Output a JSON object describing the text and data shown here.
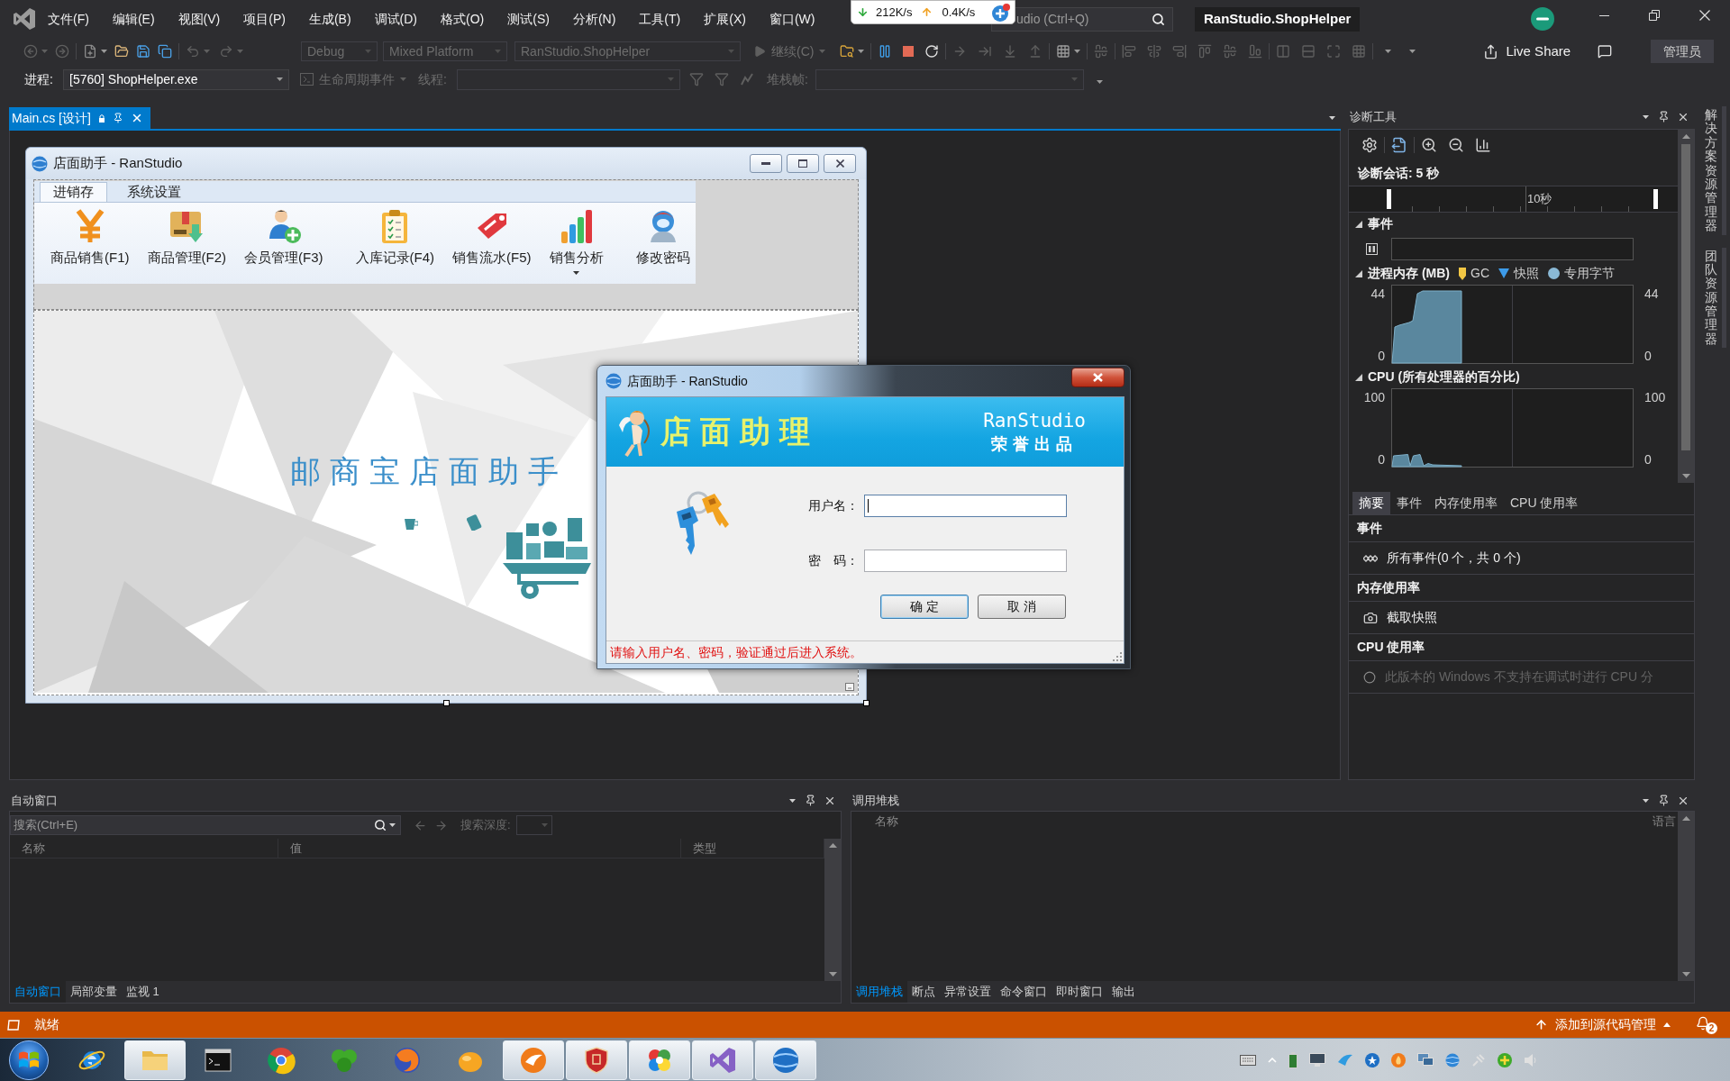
{
  "title_bar": {
    "menu": [
      "文件(F)",
      "编辑(E)",
      "视图(V)",
      "项目(P)",
      "生成(B)",
      "调试(D)",
      "格式(O)",
      "测试(S)",
      "分析(N)",
      "工具(T)",
      "扩展(X)",
      "窗口(W)"
    ],
    "quick_launch": {
      "placeholder": "udio (Ctrl+Q)"
    },
    "solution_name": "RanStudio.ShopHelper"
  },
  "net_speed_widget": {
    "download": "212K/s",
    "upload": "0.4K/s"
  },
  "toolbar": {
    "configuration": {
      "value": "Debug",
      "disabled": true
    },
    "platform": {
      "value": "Mixed Platform",
      "disabled": true
    },
    "startup_project": {
      "value": "RanStudio.ShopHelper",
      "disabled": true
    },
    "continue_button": {
      "label": "继续(C)",
      "disabled": true
    },
    "live_share": "Live Share",
    "admin_badge": "管理员"
  },
  "debug_location_bar": {
    "process_label": "进程:",
    "process": "[5760] ShopHelper.exe",
    "lifecycle_events": {
      "label": "生命周期事件",
      "disabled": true
    },
    "thread_label": {
      "label": "线程:",
      "disabled": true
    },
    "stack_frame_label": {
      "label": "堆栈帧:",
      "disabled": true
    }
  },
  "document_tabs": [
    {
      "label": "Main.cs [设计]",
      "selected": true
    }
  ],
  "designer_form": {
    "title": "店面助手 - RanStudio",
    "ribbon_tabs": [
      {
        "label": "进销存",
        "selected": true
      },
      {
        "label": "系统设置",
        "selected": false
      }
    ],
    "ribbon_groups": [
      {
        "buttons": [
          {
            "label": "商品销售(F1)",
            "dropdown": false
          },
          {
            "label": "商品管理(F2)",
            "dropdown": false
          },
          {
            "label": "会员管理(F3)",
            "dropdown": false
          }
        ]
      },
      {
        "buttons": [
          {
            "label": "入库记录(F4)",
            "dropdown": false
          },
          {
            "label": "销售流水(F5)",
            "dropdown": false
          },
          {
            "label": "销售分析",
            "dropdown": true
          }
        ]
      },
      {
        "buttons": [
          {
            "label": "修改密码",
            "dropdown": false
          }
        ]
      }
    ],
    "banner_text": "邮商宝店面助手"
  },
  "login_dialog": {
    "title": "店面助手 - RanStudio",
    "banner": {
      "title": "店面助理",
      "brand": "RanStudio",
      "tagline": "荣誉出品"
    },
    "fields": [
      {
        "label": "用户名：",
        "focused": true
      },
      {
        "label": "密　码：",
        "focused": false
      }
    ],
    "buttons": [
      {
        "label": "确 定",
        "default": true
      },
      {
        "label": "取 消",
        "default": false
      }
    ],
    "status": "请输入用户名、密码，验证通过后进入系统。"
  },
  "diagnostic_tools": {
    "title": "诊断工具",
    "session": "诊断会话: 5 秒",
    "timeline_label": "10秒",
    "sections": [
      {
        "kind": "events",
        "title": "事件",
        "expanded": true
      },
      {
        "kind": "memory",
        "title": "进程内存 (MB)",
        "expanded": true,
        "legend": [
          {
            "kind": "gc",
            "label": "GC"
          },
          {
            "kind": "snapshot",
            "label": "快照"
          },
          {
            "kind": "private_bytes",
            "label": "专用字节"
          }
        ],
        "axis": {
          "left_max": "44",
          "left_min": "0",
          "right_max": "44",
          "right_min": "0"
        }
      },
      {
        "kind": "cpu",
        "title": "CPU (所有处理器的百分比)",
        "expanded": true,
        "axis": {
          "left_max": "100",
          "left_min": "0",
          "right_max": "100",
          "right_min": "0"
        }
      }
    ],
    "tabs": [
      {
        "label": "摘要",
        "selected": true
      },
      {
        "label": "事件",
        "selected": false
      },
      {
        "label": "内存使用率",
        "selected": false
      },
      {
        "label": "CPU 使用率",
        "selected": false
      }
    ],
    "summary": [
      {
        "kind": "events",
        "heading": "事件",
        "item": "所有事件(0 个，共 0 个)",
        "disabled": false
      },
      {
        "kind": "memory",
        "heading": "内存使用率",
        "item": "截取快照",
        "disabled": false
      },
      {
        "kind": "cpu",
        "heading": "CPU 使用率",
        "item": "此版本的 Windows 不支持在调试时进行 CPU 分",
        "disabled": true
      }
    ]
  },
  "side_tabs": [
    "解决方案资源管理器",
    "团队资源管理器"
  ],
  "autos_window": {
    "title": "自动窗口",
    "search": {
      "placeholder": "搜索(Ctrl+E)"
    },
    "search_depth": {
      "label": "搜索深度:",
      "disabled": true
    },
    "columns": [
      "名称",
      "值",
      "类型"
    ],
    "tabs": [
      {
        "label": "自动窗口",
        "selected": true
      },
      {
        "label": "局部变量",
        "selected": false
      },
      {
        "label": "监视 1",
        "selected": false
      }
    ]
  },
  "call_stack_window": {
    "title": "调用堆栈",
    "columns": [
      "名称",
      "语言"
    ],
    "tabs": [
      {
        "label": "调用堆栈",
        "selected": true
      },
      {
        "label": "断点",
        "selected": false
      },
      {
        "label": "异常设置",
        "selected": false
      },
      {
        "label": "命令窗口",
        "selected": false
      },
      {
        "label": "即时窗口",
        "selected": false
      },
      {
        "label": "输出",
        "selected": false
      }
    ]
  },
  "status_bar": {
    "text": "就绪",
    "source_control": "添加到源代码管理",
    "notification_count": "2"
  },
  "taskbar": {
    "apps": [
      {
        "running": false
      },
      {
        "running": true
      },
      {
        "running": false
      },
      {
        "running": false
      },
      {
        "running": false
      },
      {
        "running": false
      },
      {
        "running": false
      },
      {
        "running": true
      },
      {
        "running": true
      },
      {
        "running": true
      },
      {
        "running": true
      },
      {
        "running": true
      }
    ]
  }
}
